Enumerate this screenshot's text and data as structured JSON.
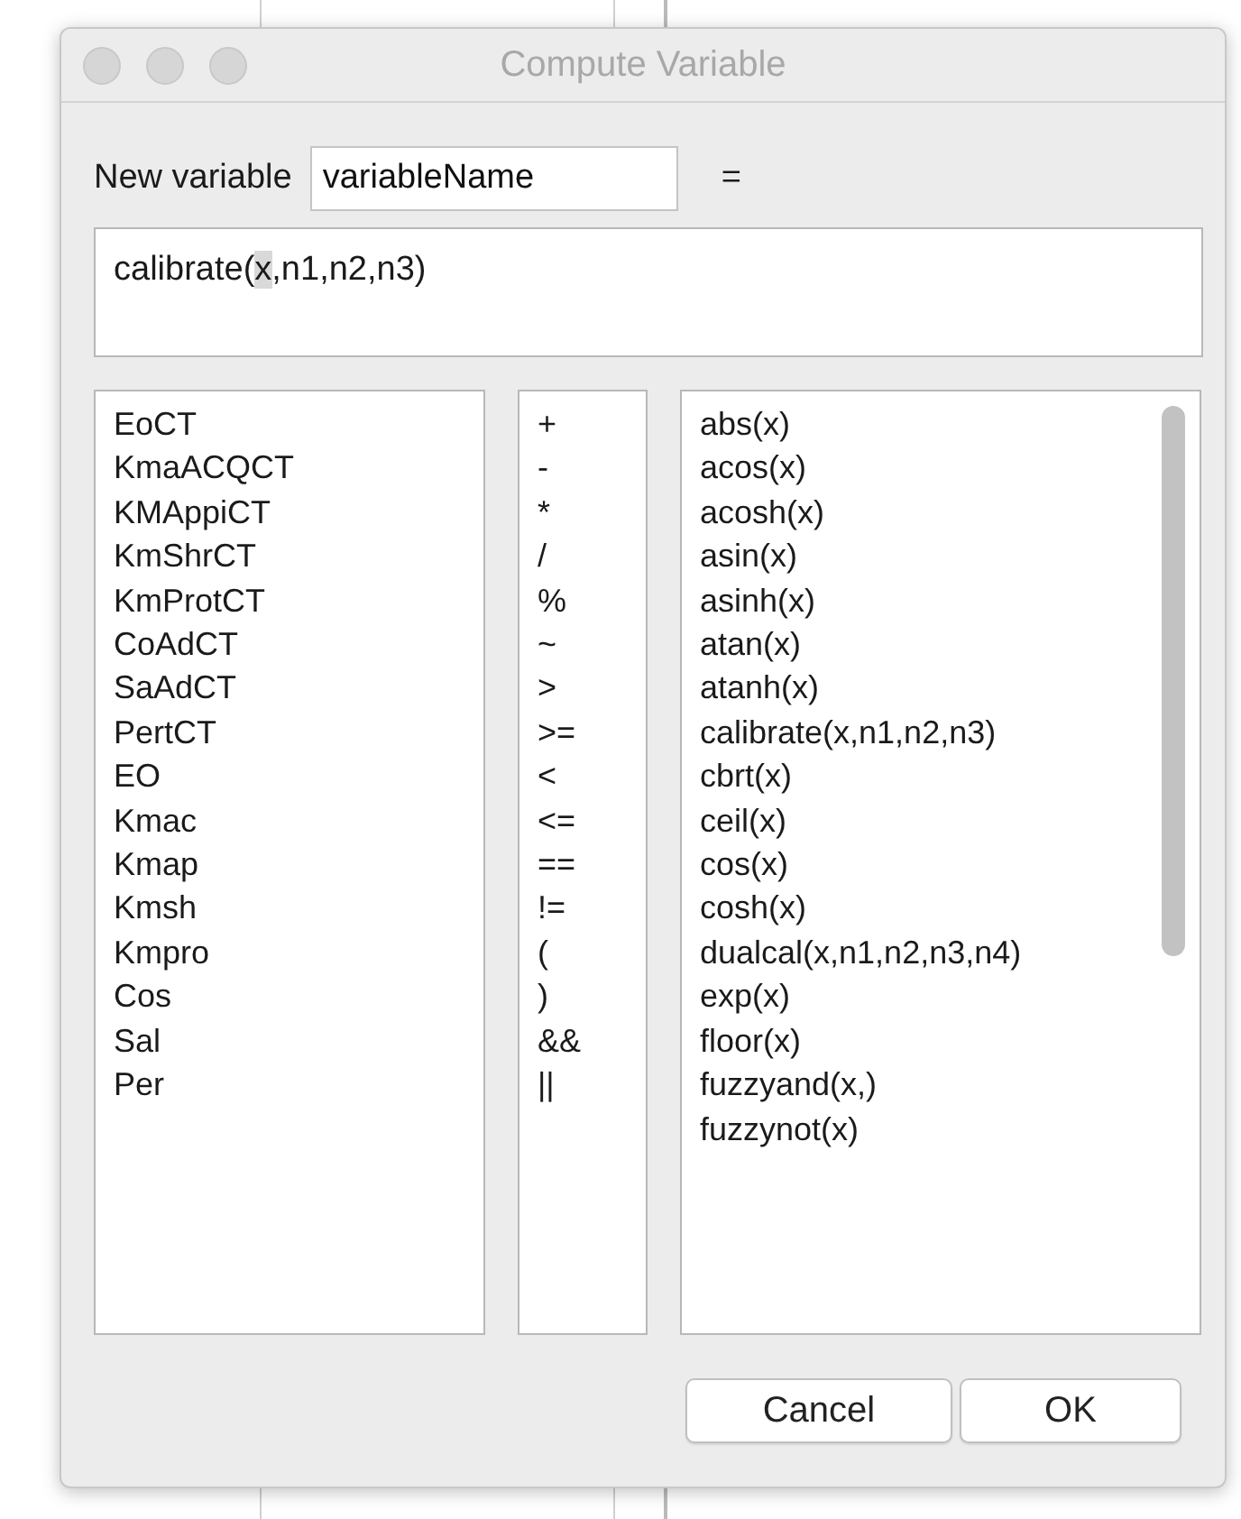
{
  "window": {
    "title": "Compute Variable"
  },
  "new_variable": {
    "label": "New variable",
    "value": "variableName",
    "equals": "="
  },
  "expression": {
    "before": "calibrate(",
    "selected": "x",
    "after": ",n1,n2,n3)"
  },
  "variables": [
    "EoCT",
    "KmaACQCT",
    "KMAppiCT",
    "KmShrCT",
    "KmProtCT",
    "CoAdCT",
    "SaAdCT",
    "PertCT",
    "EO",
    "Kmac",
    "Kmap",
    "Kmsh",
    "Kmpro",
    "Cos",
    "Sal",
    "Per"
  ],
  "operators": [
    "+",
    "-",
    "*",
    "/",
    "%",
    "~",
    ">",
    ">=",
    "<",
    "<=",
    "==",
    "!=",
    "(",
    ")",
    "&&",
    "||"
  ],
  "functions": [
    "abs(x)",
    "acos(x)",
    "acosh(x)",
    "asin(x)",
    "asinh(x)",
    "atan(x)",
    "atanh(x)",
    "calibrate(x,n1,n2,n3)",
    "cbrt(x)",
    "ceil(x)",
    "cos(x)",
    "cosh(x)",
    "dualcal(x,n1,n2,n3,n4)",
    "exp(x)",
    "floor(x)",
    "fuzzyand(x,)",
    "fuzzynot(x)"
  ],
  "buttons": [
    "Cancel",
    "OK"
  ]
}
